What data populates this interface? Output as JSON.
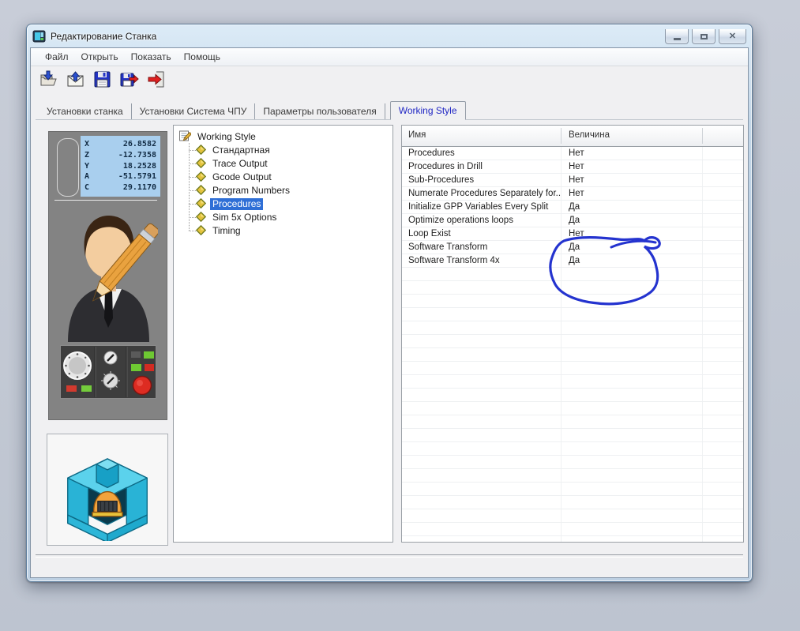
{
  "colors": {
    "selection_blue": "#2f6fd6",
    "tab_active_text": "#2127c4",
    "dro_background": "#a9cfee",
    "annotation_ink": "#2433cf",
    "panel_gray": "#838383"
  },
  "window": {
    "title": "Редактирование Станка",
    "icon": "machine-app-icon",
    "controls": [
      {
        "name": "minimize",
        "icon": "minimize-icon"
      },
      {
        "name": "maximize",
        "icon": "maximize-icon"
      },
      {
        "name": "close",
        "icon": "close-icon"
      }
    ]
  },
  "menu": {
    "items": [
      {
        "name": "file",
        "label": "Файл"
      },
      {
        "name": "open",
        "label": "Открыть"
      },
      {
        "name": "show",
        "label": "Показать"
      },
      {
        "name": "help",
        "label": "Помощь"
      }
    ]
  },
  "toolbar": {
    "buttons": [
      {
        "name": "load-from-file",
        "icon": "folder-open-down-arrow-icon"
      },
      {
        "name": "import",
        "icon": "envelope-up-arrow-icon"
      },
      {
        "name": "save",
        "icon": "floppy-disk-icon"
      },
      {
        "name": "save-as",
        "icon": "floppy-disk-export-icon"
      },
      {
        "name": "exit",
        "icon": "exit-door-arrow-icon"
      }
    ]
  },
  "tabs": [
    {
      "name": "machine-settings",
      "label": "Установки станка",
      "active": false
    },
    {
      "name": "cnc-system-settings",
      "label": "Установки Система ЧПУ",
      "active": false
    },
    {
      "name": "user-parameters",
      "label": "Параметры пользователя",
      "active": false
    },
    {
      "name": "working-style",
      "label": "Working Style",
      "active": true
    }
  ],
  "dro": {
    "axes": [
      {
        "axis": "X",
        "value": "26.8582"
      },
      {
        "axis": "Z",
        "value": "-12.7358"
      },
      {
        "axis": "Y",
        "value": "18.2528"
      },
      {
        "axis": "A",
        "value": "-51.5791"
      },
      {
        "axis": "C",
        "value": "29.1170"
      }
    ]
  },
  "tree": {
    "root": {
      "label": "Working Style",
      "icon": "notepad-pencil-icon"
    },
    "item_icon": "diamond-icon",
    "items": [
      {
        "label": "Стандартная",
        "selected": false
      },
      {
        "label": "Trace Output",
        "selected": false
      },
      {
        "label": "Gcode Output",
        "selected": false
      },
      {
        "label": "Program Numbers",
        "selected": false
      },
      {
        "label": "Procedures",
        "selected": true
      },
      {
        "label": "Sim 5x Options",
        "selected": false
      },
      {
        "label": "Timing",
        "selected": false
      }
    ]
  },
  "table": {
    "columns": [
      "Имя",
      "Величина"
    ],
    "rows": [
      {
        "name": "Procedures",
        "value": "Нет"
      },
      {
        "name": "Procedures in Drill",
        "value": "Нет"
      },
      {
        "name": "Sub-Procedures",
        "value": "Нет"
      },
      {
        "name": "Numerate Procedures Separately for...",
        "value": "Нет"
      },
      {
        "name": "Initialize GPP Variables Every Split",
        "value": "Да"
      },
      {
        "name": "Optimize operations loops",
        "value": "Да"
      },
      {
        "name": "Loop Exist",
        "value": "Нет"
      },
      {
        "name": "Software Transform",
        "value": "Да"
      },
      {
        "name": "Software Transform 4x",
        "value": "Да"
      }
    ]
  },
  "annotation": {
    "type": "freehand-circle",
    "color": "#2433cf"
  }
}
